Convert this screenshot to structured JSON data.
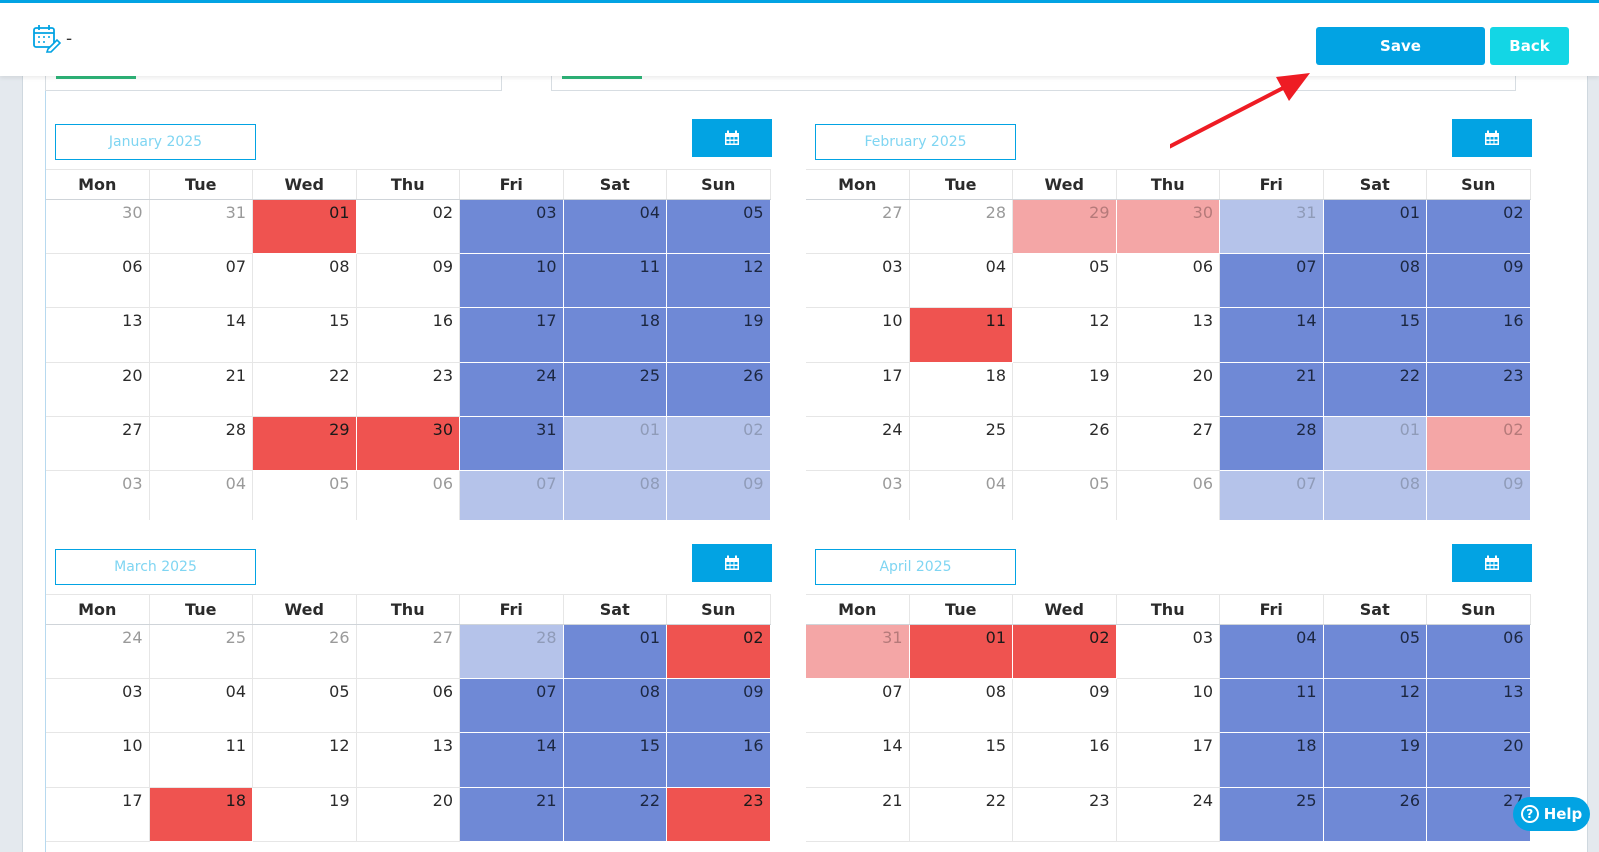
{
  "header": {
    "title": "-",
    "save_label": "Save",
    "back_label": "Back",
    "icon": "calendar-edit-icon"
  },
  "help": {
    "label": "Help",
    "icon": "question-circle-icon"
  },
  "colors": {
    "accent": "#02a3e3",
    "back": "#13d6e5",
    "weekend": "#6f89d6",
    "weekend_out": "#b5c3ea",
    "holiday": "#ef5350",
    "holiday_out": "#f4a6a6",
    "month_label_text": "#7fd5f2"
  },
  "weekdays": [
    "Mon",
    "Tue",
    "Wed",
    "Thu",
    "Fri",
    "Sat",
    "Sun"
  ],
  "months": [
    {
      "label": "January 2025",
      "button_icon": "calendar-icon",
      "days": [
        [
          "30",
          "31",
          "01",
          "02",
          "03",
          "04",
          "05"
        ],
        [
          "06",
          "07",
          "08",
          "09",
          "10",
          "11",
          "12"
        ],
        [
          "13",
          "14",
          "15",
          "16",
          "17",
          "18",
          "19"
        ],
        [
          "20",
          "21",
          "22",
          "23",
          "24",
          "25",
          "26"
        ],
        [
          "27",
          "28",
          "29",
          "30",
          "31",
          "01",
          "02"
        ],
        [
          "03",
          "04",
          "05",
          "06",
          "07",
          "08",
          "09"
        ]
      ],
      "status": [
        [
          "out",
          "out",
          "holiday",
          "",
          "weekend",
          "weekend",
          "weekend"
        ],
        [
          "",
          "",
          "",
          "",
          "weekend",
          "weekend",
          "weekend"
        ],
        [
          "",
          "",
          "",
          "",
          "weekend",
          "weekend",
          "weekend"
        ],
        [
          "",
          "",
          "",
          "",
          "weekend",
          "weekend",
          "weekend"
        ],
        [
          "",
          "",
          "holiday",
          "holiday",
          "weekend",
          "weekend-out",
          "weekend-out"
        ],
        [
          "out",
          "out",
          "out",
          "out",
          "weekend-out",
          "weekend-out",
          "weekend-out"
        ]
      ]
    },
    {
      "label": "February 2025",
      "button_icon": "calendar-icon",
      "days": [
        [
          "27",
          "28",
          "29",
          "30",
          "31",
          "01",
          "02"
        ],
        [
          "03",
          "04",
          "05",
          "06",
          "07",
          "08",
          "09"
        ],
        [
          "10",
          "11",
          "12",
          "13",
          "14",
          "15",
          "16"
        ],
        [
          "17",
          "18",
          "19",
          "20",
          "21",
          "22",
          "23"
        ],
        [
          "24",
          "25",
          "26",
          "27",
          "28",
          "01",
          "02"
        ],
        [
          "03",
          "04",
          "05",
          "06",
          "07",
          "08",
          "09"
        ]
      ],
      "status": [
        [
          "out",
          "out",
          "holiday-out",
          "holiday-out",
          "weekend-out",
          "weekend",
          "weekend"
        ],
        [
          "",
          "",
          "",
          "",
          "weekend",
          "weekend",
          "weekend"
        ],
        [
          "",
          "holiday",
          "",
          "",
          "weekend",
          "weekend",
          "weekend"
        ],
        [
          "",
          "",
          "",
          "",
          "weekend",
          "weekend",
          "weekend"
        ],
        [
          "",
          "",
          "",
          "",
          "weekend",
          "weekend-out",
          "holiday-out"
        ],
        [
          "out",
          "out",
          "out",
          "out",
          "weekend-out",
          "weekend-out",
          "weekend-out"
        ]
      ]
    },
    {
      "label": "March 2025",
      "button_icon": "calendar-icon",
      "days": [
        [
          "24",
          "25",
          "26",
          "27",
          "28",
          "01",
          "02"
        ],
        [
          "03",
          "04",
          "05",
          "06",
          "07",
          "08",
          "09"
        ],
        [
          "10",
          "11",
          "12",
          "13",
          "14",
          "15",
          "16"
        ],
        [
          "17",
          "18",
          "19",
          "20",
          "21",
          "22",
          "23"
        ]
      ],
      "status": [
        [
          "out",
          "out",
          "out",
          "out",
          "weekend-out",
          "weekend",
          "holiday"
        ],
        [
          "",
          "",
          "",
          "",
          "weekend",
          "weekend",
          "weekend"
        ],
        [
          "",
          "",
          "",
          "",
          "weekend",
          "weekend",
          "weekend"
        ],
        [
          "",
          "holiday",
          "",
          "",
          "weekend",
          "weekend",
          "holiday"
        ]
      ]
    },
    {
      "label": "April 2025",
      "button_icon": "calendar-icon",
      "days": [
        [
          "31",
          "01",
          "02",
          "03",
          "04",
          "05",
          "06"
        ],
        [
          "07",
          "08",
          "09",
          "10",
          "11",
          "12",
          "13"
        ],
        [
          "14",
          "15",
          "16",
          "17",
          "18",
          "19",
          "20"
        ],
        [
          "21",
          "22",
          "23",
          "24",
          "25",
          "26",
          "27"
        ]
      ],
      "status": [
        [
          "holiday-out",
          "holiday",
          "holiday",
          "",
          "weekend",
          "weekend",
          "weekend"
        ],
        [
          "",
          "",
          "",
          "",
          "weekend",
          "weekend",
          "weekend"
        ],
        [
          "",
          "",
          "",
          "",
          "weekend",
          "weekend",
          "weekend"
        ],
        [
          "",
          "",
          "",
          "",
          "weekend",
          "weekend",
          "weekend"
        ]
      ]
    }
  ]
}
